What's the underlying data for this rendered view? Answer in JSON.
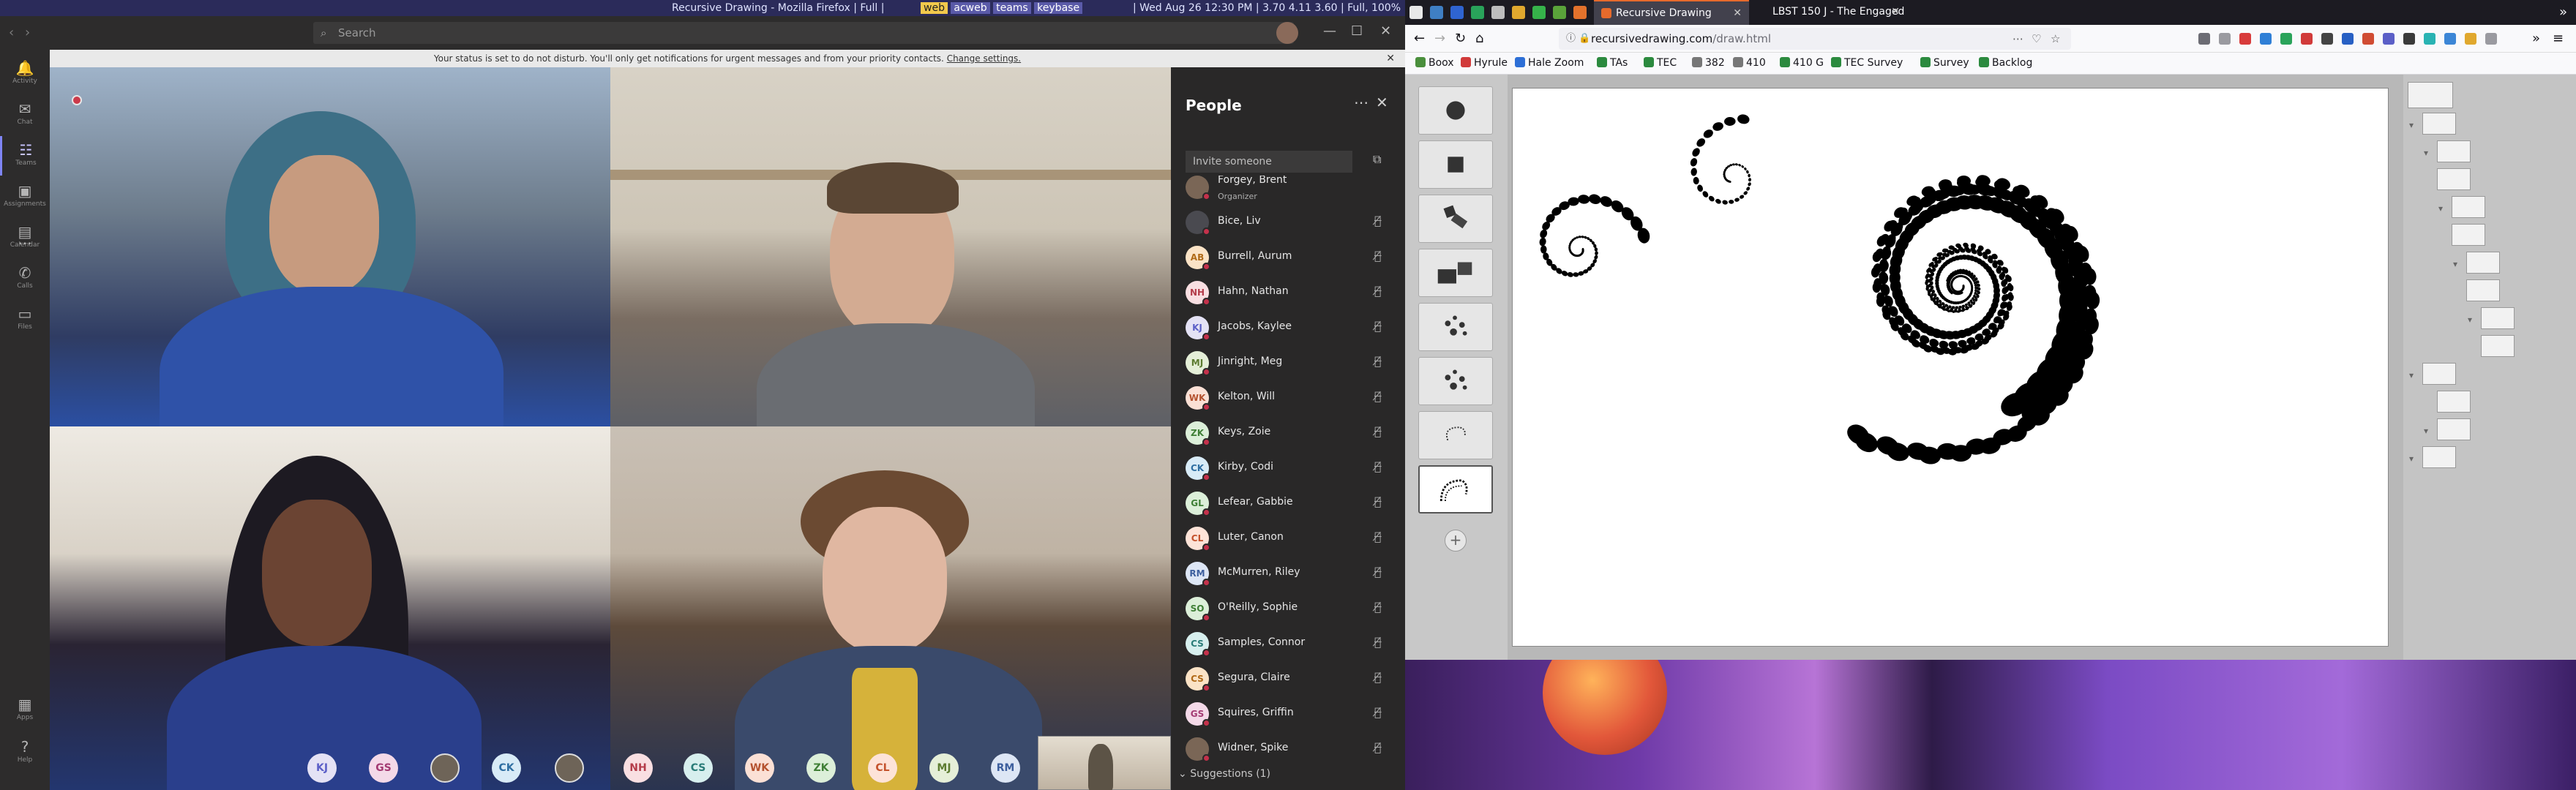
{
  "system_bar": {
    "title": "Recursive Drawing - Mozilla Firefox | Full |",
    "workspaces": [
      {
        "label": "web",
        "active": true
      },
      {
        "label": "acweb",
        "active": false
      },
      {
        "label": "teams",
        "active": false
      },
      {
        "label": "keybase",
        "active": false
      }
    ],
    "status": "| Wed Aug 26 12:30 PM | 3.70 4.11 3.60 | Full, 100%"
  },
  "teams": {
    "search_placeholder": "Search",
    "rail": [
      {
        "icon": "bell-icon",
        "label": "Activity"
      },
      {
        "icon": "chat-icon",
        "label": "Chat"
      },
      {
        "icon": "teams-icon",
        "label": "Teams",
        "active": true
      },
      {
        "icon": "backpack-icon",
        "label": "Assignments"
      },
      {
        "icon": "calendar-icon",
        "label": "Calendar"
      },
      {
        "icon": "phone-icon",
        "label": "Calls"
      },
      {
        "icon": "file-icon",
        "label": "Files"
      }
    ],
    "rail_more": "...",
    "rail_apps": "Apps",
    "rail_help": "Help",
    "notice": {
      "text": "Your status is set to do not disturb. You'll only get notifications for urgent messages and from your priority contacts.",
      "link": "Change settings."
    },
    "avatar_strip": [
      {
        "initials": "KJ",
        "bg": "#e4e2f5",
        "fg": "#5b5fc7"
      },
      {
        "initials": "GS",
        "bg": "#f4d9e8",
        "fg": "#a33a72"
      },
      {
        "initials": "",
        "photo": true
      },
      {
        "initials": "CK",
        "bg": "#d8ebf7",
        "fg": "#2f6fa2"
      },
      {
        "initials": "",
        "photo": true
      },
      {
        "initials": "NH",
        "bg": "#f9dfe2",
        "fg": "#b43c4a"
      },
      {
        "initials": "CS",
        "bg": "#d7efee",
        "fg": "#2a7c78"
      },
      {
        "initials": "WK",
        "bg": "#fbe0d5",
        "fg": "#b5522f"
      },
      {
        "initials": "ZK",
        "bg": "#dcefd9",
        "fg": "#3f7f36"
      },
      {
        "initials": "CL",
        "bg": "#fde3d8",
        "fg": "#c4522c"
      },
      {
        "initials": "MJ",
        "bg": "#e5efd8",
        "fg": "#5d7c31"
      },
      {
        "initials": "RM",
        "bg": "#dde6f5",
        "fg": "#3d5f9e"
      }
    ],
    "people": {
      "title": "People",
      "invite_placeholder": "Invite someone",
      "list": [
        {
          "name": "Forgey, Brent",
          "role": "Organizer",
          "initials": "",
          "photo": true
        },
        {
          "name": "Bice, Liv",
          "initials": "",
          "photo": true,
          "bg": "#4a4a50"
        },
        {
          "name": "Burrell, Aurum",
          "initials": "AB",
          "bg": "#fbe3c6",
          "fg": "#b06a17"
        },
        {
          "name": "Hahn, Nathan",
          "initials": "NH",
          "bg": "#f9dfe2",
          "fg": "#b43c4a"
        },
        {
          "name": "Jacobs, Kaylee",
          "initials": "KJ",
          "bg": "#e4e2f5",
          "fg": "#5b5fc7"
        },
        {
          "name": "Jinright, Meg",
          "initials": "MJ",
          "bg": "#e5efd8",
          "fg": "#5d7c31"
        },
        {
          "name": "Kelton, Will",
          "initials": "WK",
          "bg": "#fbe0d5",
          "fg": "#b5522f"
        },
        {
          "name": "Keys, Zoie",
          "initials": "ZK",
          "bg": "#dcefd9",
          "fg": "#3f7f36"
        },
        {
          "name": "Kirby, Codi",
          "initials": "CK",
          "bg": "#d8ebf7",
          "fg": "#2f6fa2"
        },
        {
          "name": "Lefear, Gabbie",
          "initials": "GL",
          "bg": "#dcefd9",
          "fg": "#3f7f36"
        },
        {
          "name": "Luter, Canon",
          "initials": "CL",
          "bg": "#fde3d8",
          "fg": "#c4522c"
        },
        {
          "name": "McMurren, Riley",
          "initials": "RM",
          "bg": "#dde6f5",
          "fg": "#3d5f9e"
        },
        {
          "name": "O'Reilly, Sophie",
          "initials": "SO",
          "bg": "#dcefd9",
          "fg": "#3f7f36"
        },
        {
          "name": "Samples, Connor",
          "initials": "CS",
          "bg": "#d7efee",
          "fg": "#2a7c78"
        },
        {
          "name": "Segura, Claire",
          "initials": "CS",
          "bg": "#fbe3c6",
          "fg": "#b06a17"
        },
        {
          "name": "Squires, Griffin",
          "initials": "GS",
          "bg": "#f4d9e8",
          "fg": "#a33a72"
        },
        {
          "name": "Widner, Spike",
          "initials": "",
          "photo": true
        }
      ],
      "suggestions": "Suggestions (1)"
    }
  },
  "firefox": {
    "tabs": [
      {
        "title": "Recursive Drawing",
        "active": true
      },
      {
        "title": "LBST 150 J - The Engaged C",
        "active": false
      }
    ],
    "url_host": "recursivedrawing.com",
    "url_path": "/draw.html",
    "bookmarks": [
      {
        "label": "Boox",
        "color": "#4a8f3c"
      },
      {
        "label": "Hyrule",
        "color": "#d13a3a"
      },
      {
        "label": "Hale Zoom",
        "color": "#2d6fd6"
      },
      {
        "label": "TAs",
        "color": "#2b8a3e"
      },
      {
        "label": "TEC",
        "color": "#2b8a3e"
      },
      {
        "label": "382",
        "color": "#777777"
      },
      {
        "label": "410",
        "color": "#777777"
      },
      {
        "label": "410 G",
        "color": "#2b8a3e"
      },
      {
        "label": "TEC Survey",
        "color": "#2b8a3e"
      },
      {
        "label": "Survey",
        "color": "#2b8a3e"
      },
      {
        "label": "Backlog",
        "color": "#2b8a3e"
      }
    ],
    "tools": [
      {
        "name": "circle-tool-icon"
      },
      {
        "name": "square-tool-icon"
      },
      {
        "name": "shape-1-tool-icon"
      },
      {
        "name": "shape-2-tool-icon"
      },
      {
        "name": "shape-3-tool-icon"
      },
      {
        "name": "shape-4-tool-icon"
      },
      {
        "name": "spiral-tool-icon"
      },
      {
        "name": "recursive-shape-tool-icon",
        "active": true
      }
    ]
  },
  "colors": {
    "teams_accent": "#7f85f5",
    "dnd_red": "#c4314b",
    "firefox_tab_accent": "#e66a2c"
  }
}
